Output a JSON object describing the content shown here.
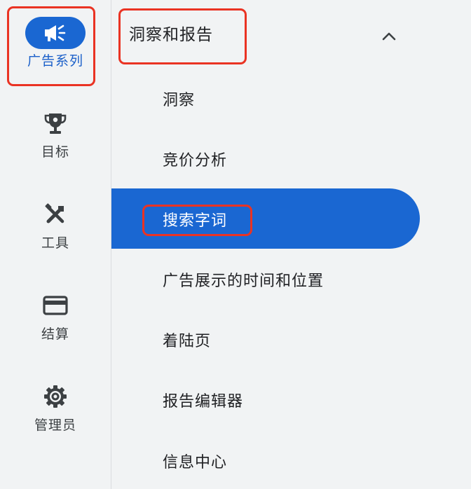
{
  "nav_rail": {
    "items": [
      {
        "label": "广告系列",
        "icon": "megaphone-icon",
        "active": true
      },
      {
        "label": "目标",
        "icon": "trophy-icon"
      },
      {
        "label": "工具",
        "icon": "tools-icon"
      },
      {
        "label": "结算",
        "icon": "credit-card-icon"
      },
      {
        "label": "管理员",
        "icon": "gear-icon"
      }
    ]
  },
  "menu": {
    "section_title": "洞察和报告",
    "section_expanded": true,
    "items": [
      {
        "label": "洞察"
      },
      {
        "label": "竞价分析"
      },
      {
        "label": "搜索字词",
        "selected": true
      },
      {
        "label": "广告展示的时间和位置"
      },
      {
        "label": "着陆页"
      },
      {
        "label": "报告编辑器"
      },
      {
        "label": "信息中心"
      }
    ]
  },
  "colors": {
    "accent": "#1a67d2",
    "active_label": "#1a5fc9",
    "highlight_box": "#ea3323",
    "background": "#f1f3f4",
    "text": "#202124"
  }
}
